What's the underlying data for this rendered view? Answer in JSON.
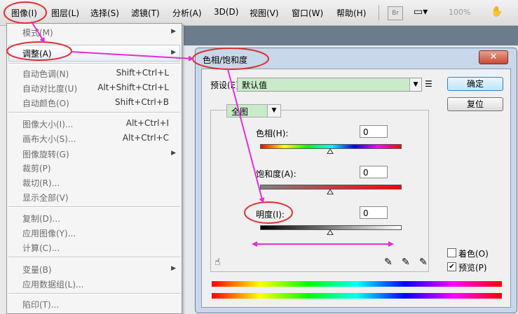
{
  "menubar": {
    "items": [
      "图像(I)",
      "图层(L)",
      "选择(S)",
      "滤镜(T)",
      "分析(A)",
      "3D(D)",
      "视图(V)",
      "窗口(W)",
      "帮助(H)"
    ],
    "br_label": "Br",
    "zoom": "100%"
  },
  "menu": {
    "mode": "模式(M)",
    "adjust": "调整(A)",
    "auto_tone": "自动色调(N)",
    "auto_tone_key": "Shift+Ctrl+L",
    "auto_contrast": "自动对比度(U)",
    "auto_contrast_key": "Alt+Shift+Ctrl+L",
    "auto_color": "自动颜色(O)",
    "auto_color_key": "Shift+Ctrl+B",
    "image_size": "图像大小(I)...",
    "image_size_key": "Alt+Ctrl+I",
    "canvas_size": "画布大小(S)...",
    "canvas_size_key": "Alt+Ctrl+C",
    "rotate": "图像旋转(G)",
    "crop": "裁剪(P)",
    "trim": "裁切(R)...",
    "reveal_all": "显示全部(V)",
    "duplicate": "复制(D)...",
    "apply_image": "应用图像(Y)...",
    "calculations": "计算(C)...",
    "variables": "变量(B)",
    "apply_dataset": "应用数据组(L)...",
    "trap": "陷印(T)..."
  },
  "dialog": {
    "title": "色相/饱和度",
    "close": "✕",
    "preset_label": "预设(E):",
    "preset_value": "默认值",
    "ok": "确定",
    "reset": "复位",
    "channel": "全图",
    "hue_label": "色相(H):",
    "hue_value": "0",
    "sat_label": "饱和度(A):",
    "sat_value": "0",
    "light_label": "明度(I):",
    "light_value": "0",
    "colorize": "着色(O)",
    "colorize_checked": false,
    "preview": "预览(P)",
    "preview_checked": true
  },
  "colors": {
    "annotation": "#e62bd8",
    "highlight_field": "#c9ebc9"
  }
}
